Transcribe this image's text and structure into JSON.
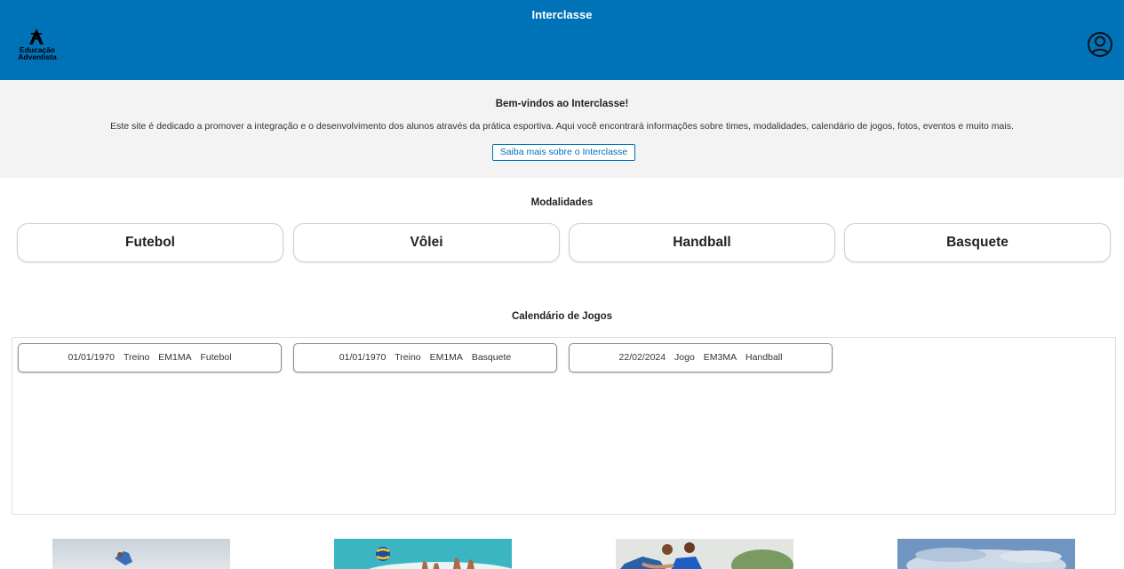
{
  "header": {
    "title": "Interclasse",
    "logo_text_line1": "Educação",
    "logo_text_line2": "Adventista",
    "logo_icon": "education-logo-icon",
    "profile_icon": "user-circle-icon",
    "background_color": "#0072b8"
  },
  "welcome": {
    "heading": "Bem-vindos ao Interclasse!",
    "description": "Este site é dedicado a promover a integração e o desenvolvimento dos alunos através da prática esportiva. Aqui você encontrará informações sobre times, modalidades, calendário de jogos, fotos, eventos e muito mais.",
    "button_label": "Saiba mais sobre o Interclasse"
  },
  "modalidades": {
    "title": "Modalidades",
    "items": [
      {
        "label": "Futebol"
      },
      {
        "label": "Vôlei"
      },
      {
        "label": "Handball"
      },
      {
        "label": "Basquete"
      }
    ]
  },
  "calendario": {
    "title": "Calendário de Jogos",
    "games": [
      {
        "date": "01/01/1970",
        "type": "Treino",
        "class": "EM1MA",
        "sport": "Futebol"
      },
      {
        "date": "01/01/1970",
        "type": "Treino",
        "class": "EM1MA",
        "sport": "Basquete"
      },
      {
        "date": "22/02/2024",
        "type": "Jogo",
        "class": "EM3MA",
        "sport": "Handball"
      }
    ]
  },
  "photos": [
    {
      "name": "football-photo"
    },
    {
      "name": "volleyball-photo"
    },
    {
      "name": "handball-photo"
    },
    {
      "name": "basketball-photo"
    }
  ]
}
